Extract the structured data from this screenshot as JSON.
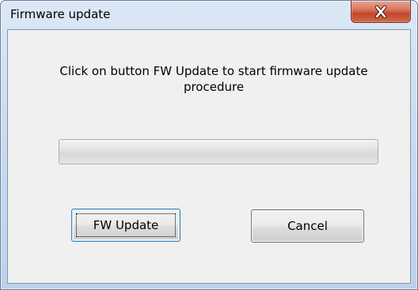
{
  "window": {
    "title": "Firmware update"
  },
  "titlebar": {
    "close_icon": "close-x-icon",
    "close_color": "#c2462c"
  },
  "dialog": {
    "message": "Click on button FW Update to start firmware update procedure",
    "progress": 0,
    "buttons": {
      "fw_update_label": "FW Update",
      "cancel_label": "Cancel"
    }
  }
}
